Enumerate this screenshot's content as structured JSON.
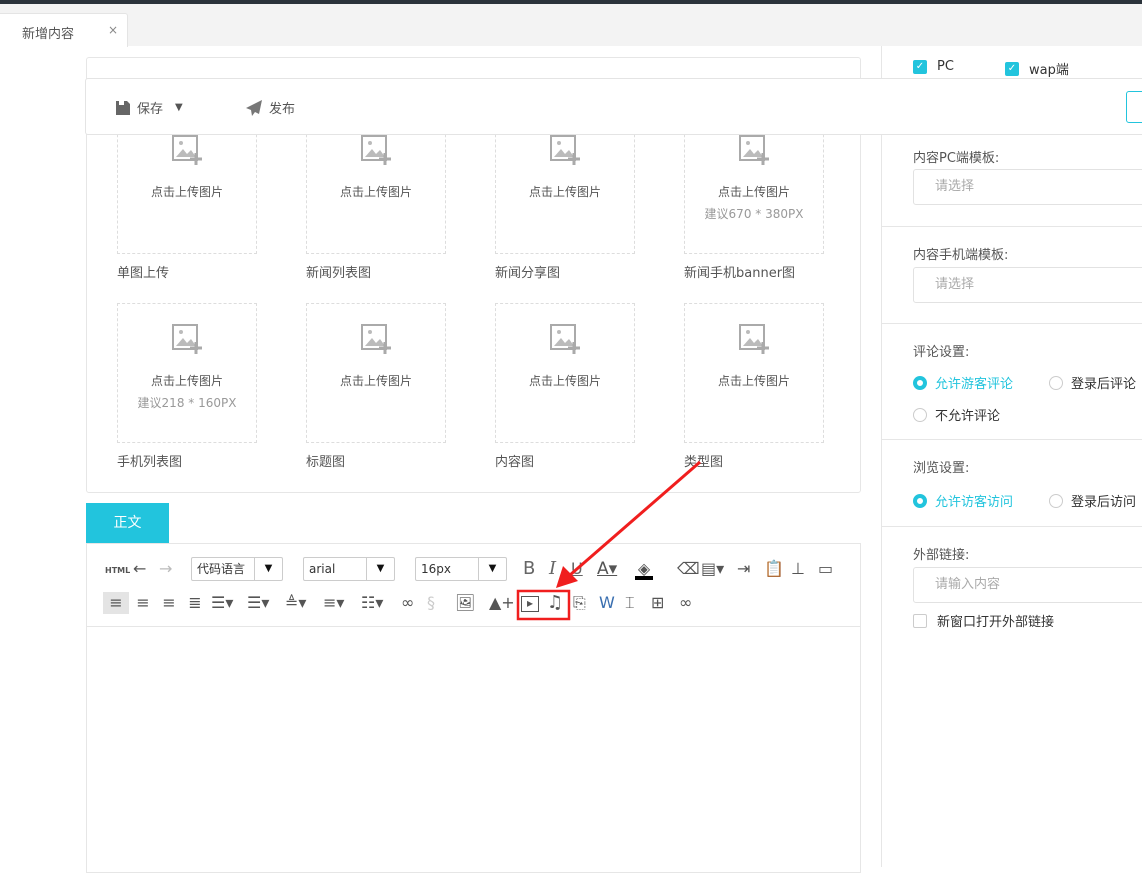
{
  "tab": {
    "title": "新增内容",
    "close": "×"
  },
  "actions": {
    "save": "保存",
    "publish": "发布"
  },
  "uploads": [
    {
      "text": "点击上传图片",
      "hint": "",
      "label": "单图上传"
    },
    {
      "text": "点击上传图片",
      "hint": "",
      "label": "新闻列表图"
    },
    {
      "text": "点击上传图片",
      "hint": "",
      "label": "新闻分享图"
    },
    {
      "text": "点击上传图片",
      "hint": "建议670 * 380PX",
      "label": "新闻手机banner图"
    },
    {
      "text": "点击上传图片",
      "hint": "建议218 * 160PX",
      "label": "手机列表图"
    },
    {
      "text": "点击上传图片",
      "hint": "",
      "label": "标题图"
    },
    {
      "text": "点击上传图片",
      "hint": "",
      "label": "内容图"
    },
    {
      "text": "点击上传图片",
      "hint": "",
      "label": "类型图"
    }
  ],
  "editor": {
    "tab": "正文",
    "html": "HTML",
    "code_lang": "代码语言",
    "font": "arial",
    "size": "16px"
  },
  "right": {
    "platforms": [
      {
        "label": "PC",
        "checked": true
      },
      {
        "label": "wap端",
        "checked": true
      }
    ],
    "pc_template": {
      "label": "内容PC端模板:",
      "placeholder": "请选择"
    },
    "mobile_template": {
      "label": "内容手机端模板:",
      "placeholder": "请选择"
    },
    "comment": {
      "label": "评论设置:",
      "options": [
        "允许游客评论",
        "登录后评论",
        "不允许评论"
      ],
      "selected": 0
    },
    "browse": {
      "label": "浏览设置:",
      "options": [
        "允许访客访问",
        "登录后访问"
      ],
      "selected": 0
    },
    "link": {
      "label": "外部链接:",
      "placeholder": "请输入内容",
      "new_window": "新窗口打开外部链接"
    }
  },
  "colors": {
    "accent": "#22c4dd",
    "annotation": "#f01e1e"
  }
}
